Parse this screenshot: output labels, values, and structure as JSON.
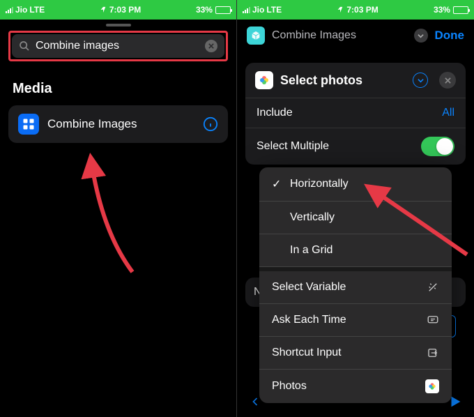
{
  "status": {
    "carrier": "Jio",
    "network": "LTE",
    "time": "7:03 PM",
    "battery_pct": "33%"
  },
  "left": {
    "search_value": "Combine images",
    "section": "Media",
    "action_label": "Combine Images"
  },
  "right": {
    "header_title": "Combine Images",
    "done": "Done",
    "card_title": "Select photos",
    "include_label": "Include",
    "include_value": "All",
    "multiple_label": "Select Multiple",
    "bg_letter": "N",
    "menu": {
      "opt1": "Horizontally",
      "opt2": "Vertically",
      "opt3": "In a Grid",
      "sv": "Select Variable",
      "ask": "Ask Each Time",
      "si": "Shortcut Input",
      "photos": "Photos"
    }
  }
}
